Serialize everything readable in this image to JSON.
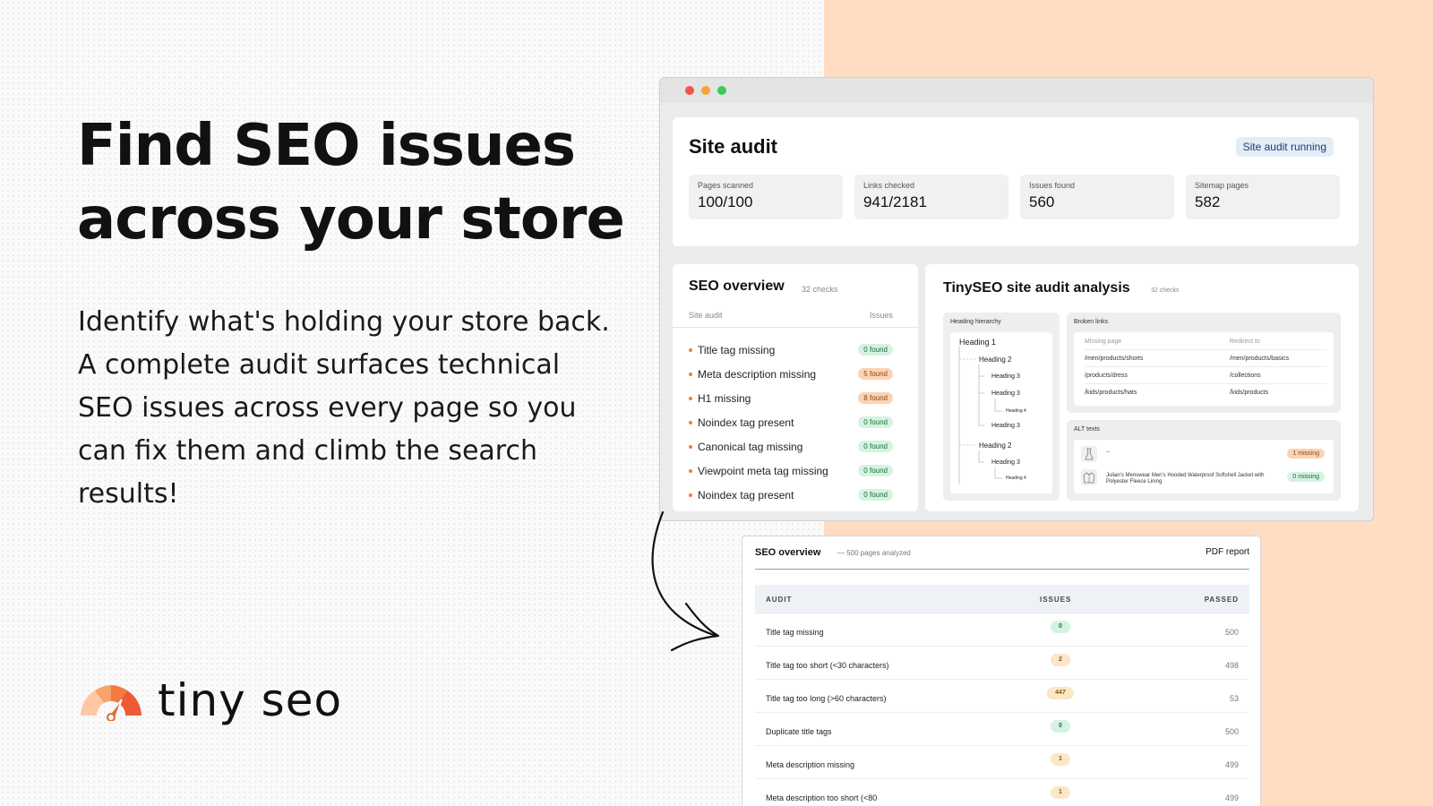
{
  "hero": {
    "headline_line1": "Find SEO issues",
    "headline_line2": "across your store",
    "subcopy": "Identify what's holding your store back. A complete audit surfaces technical SEO issues across every page so you can fix them and climb the search results!"
  },
  "logo": {
    "text": "tiny seo"
  },
  "colors": {
    "accent": "#f47a42",
    "peach": "#ffdcc2"
  },
  "window": {
    "site_audit": {
      "title": "Site audit",
      "status_badge": "Site audit running",
      "stats": [
        {
          "label": "Pages scanned",
          "value": "100/100"
        },
        {
          "label": "Links checked",
          "value": "941/2181"
        },
        {
          "label": "Issues found",
          "value": "560"
        },
        {
          "label": "Sitemap pages",
          "value": "582"
        }
      ]
    },
    "seo_overview": {
      "title": "SEO overview",
      "subtitle": "32 checks",
      "col_audit": "Site audit",
      "col_issues": "Issues",
      "items": [
        {
          "label": "Title tag missing",
          "badge": "0 found",
          "tone": "green"
        },
        {
          "label": "Meta description missing",
          "badge": "5 found",
          "tone": "orange"
        },
        {
          "label": "H1 missing",
          "badge": "8 found",
          "tone": "orange"
        },
        {
          "label": "Noindex tag present",
          "badge": "0 found",
          "tone": "green"
        },
        {
          "label": "Canonical tag missing",
          "badge": "0 found",
          "tone": "green"
        },
        {
          "label": "Viewpoint meta tag missing",
          "badge": "0 found",
          "tone": "green"
        },
        {
          "label": "Noindex tag present",
          "badge": "0 found",
          "tone": "green"
        }
      ]
    },
    "analysis": {
      "title": "TinySEO site audit analysis",
      "subtitle": "32 checks",
      "heading_hierarchy": {
        "label": "Heading hierarchy",
        "items": [
          "Heading 1",
          "Heading 2",
          "Heading 3",
          "Heading 3",
          "Heading 4",
          "Heading 3",
          "Heading 2",
          "Heading 3",
          "Heading 4"
        ]
      },
      "broken_links": {
        "label": "Broken links",
        "col_missing": "Missing page",
        "col_redirect": "Redirect to",
        "rows": [
          {
            "missing": "/men/products/shorts",
            "redirect": "/men/products/basics"
          },
          {
            "missing": "/products/dress",
            "redirect": "/collections"
          },
          {
            "missing": "/kids/products/hats",
            "redirect": "/kids/products"
          }
        ]
      },
      "alt_texts": {
        "label": "ALT texts",
        "rows": [
          {
            "text": "--",
            "badge": "1 missing",
            "tone": "orange"
          },
          {
            "text": "Julian's Menswear Men's Hooded Waterproof Softshell Jacket with Polyester Fleece Lining",
            "badge": "0 missing",
            "tone": "green"
          }
        ]
      }
    }
  },
  "pdf_report": {
    "title": "SEO overview",
    "subtitle": "— 500 pages analyzed",
    "link": "PDF report",
    "col_audit": "AUDIT",
    "col_issues": "ISSUES",
    "col_passed": "PASSED",
    "rows": [
      {
        "audit": "Title tag missing",
        "issues": "0",
        "passed": "500",
        "tone": "g"
      },
      {
        "audit": "Title tag too short (<30 characters)",
        "issues": "2",
        "passed": "498",
        "tone": "o"
      },
      {
        "audit": "Title tag too long (>60 characters)",
        "issues": "447",
        "passed": "53",
        "tone": "o"
      },
      {
        "audit": "Duplicate title tags",
        "issues": "0",
        "passed": "500",
        "tone": "g"
      },
      {
        "audit": "Meta description missing",
        "issues": "1",
        "passed": "499",
        "tone": "o"
      },
      {
        "audit": "Meta description too short (<80",
        "issues": "1",
        "passed": "499",
        "tone": "o"
      }
    ]
  }
}
